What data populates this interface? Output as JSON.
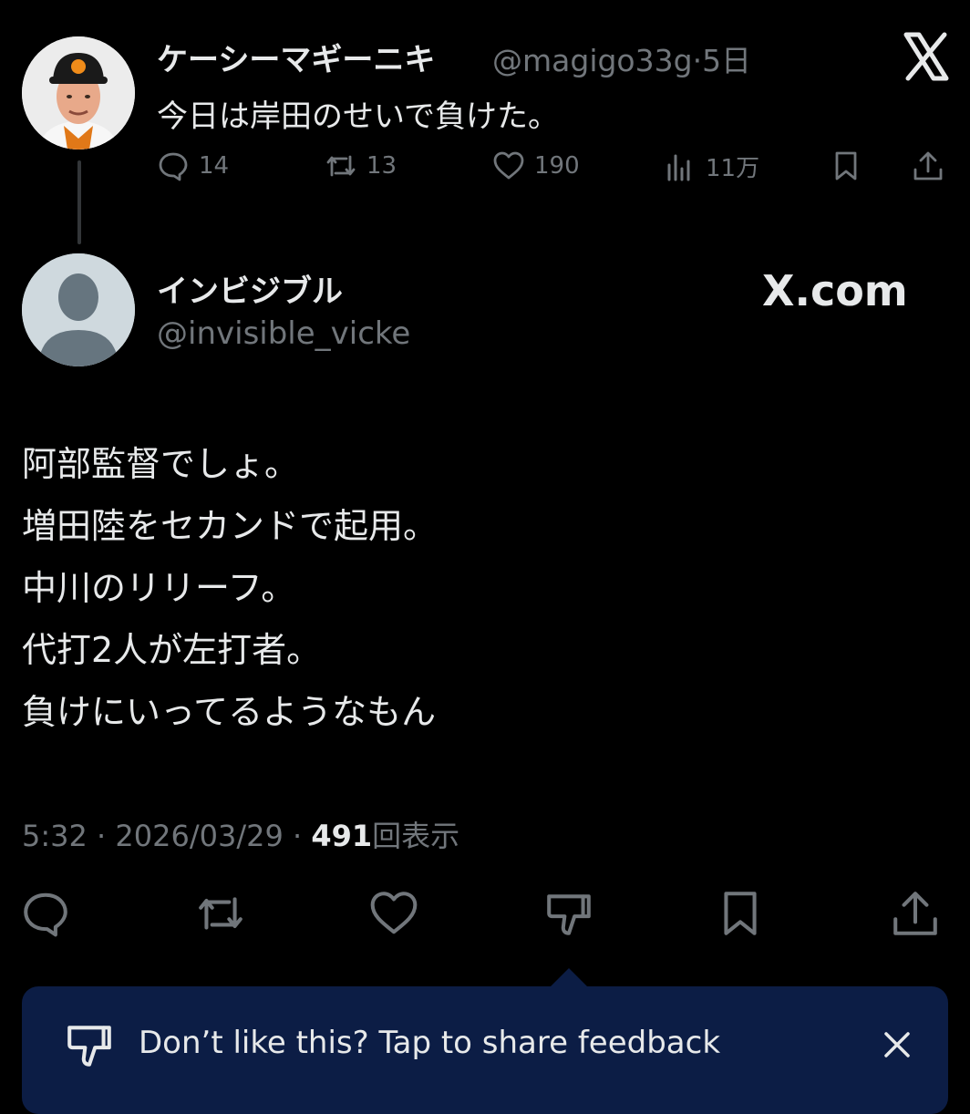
{
  "parent_tweet": {
    "name": "ケーシーマギーニキ",
    "handle": "@magigo33g",
    "separator": "·",
    "time_ago": "5日",
    "text": "今日は岸田のせいで負けた。",
    "stats": {
      "replies": "14",
      "reposts": "13",
      "likes": "190",
      "views": "11万"
    }
  },
  "reply": {
    "name": "インビジブル",
    "handle": "@invisible_vicke",
    "brand": "X.com",
    "lines": [
      "阿部監督でしょ。",
      "増田陸をセカンドで起用。",
      "中川のリリーフ。",
      "代打2人が左打者。",
      "負けにいってるようなもん"
    ],
    "time": "5:32",
    "date": "2026/03/29",
    "dot": "·",
    "view_count": "491",
    "view_label": "回表示"
  },
  "toast": {
    "text": "Don’t like this? Tap to share feedback"
  },
  "icons": {
    "logo": "x-logo-icon",
    "reply": "reply-icon",
    "repost": "repost-icon",
    "like": "heart-icon",
    "views": "views-icon",
    "bookmark": "bookmark-icon",
    "share": "share-icon",
    "dislike": "thumbs-down-icon",
    "close": "close-icon"
  },
  "colors": {
    "background": "#000000",
    "text": "#e7e9ea",
    "muted": "#71767b",
    "toast": "#0c1d45"
  }
}
